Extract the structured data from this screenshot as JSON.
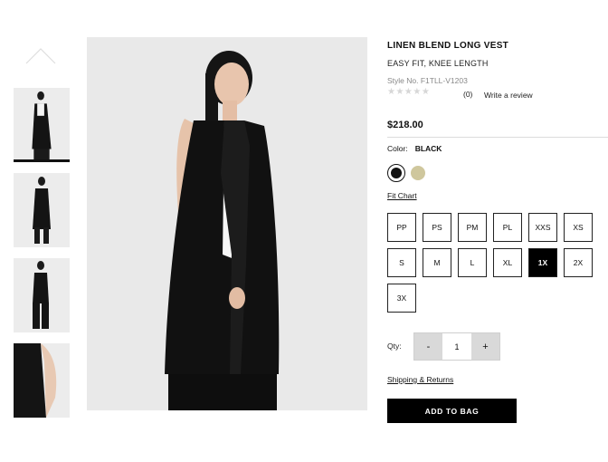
{
  "product": {
    "title": "LINEN BLEND LONG VEST",
    "subtitle": "EASY FIT, KNEE LENGTH",
    "style_no": "Style No. F1TLL-V1203",
    "rating_stars": "★★★★★",
    "review_count": "(0)",
    "write_review": "Write a review",
    "price": "$218.00"
  },
  "color": {
    "label": "Color:",
    "selected": "BLACK",
    "swatches": [
      {
        "name": "black",
        "hex": "#111111"
      },
      {
        "name": "tan",
        "hex": "#cfc79d"
      }
    ]
  },
  "fit_chart": "Fit Chart",
  "sizes": [
    "PP",
    "PS",
    "PM",
    "PL",
    "XXS",
    "XS",
    "S",
    "M",
    "L",
    "XL",
    "1X",
    "2X",
    "3X"
  ],
  "selected_size": "1X",
  "quantity": {
    "label": "Qty:",
    "minus": "-",
    "value": "1",
    "plus": "+"
  },
  "shipping": "Shipping & Returns",
  "add_to_bag": "ADD TO BAG",
  "icons": {
    "thumb_nav": "chevron-up-icon",
    "rating": "star-icon"
  }
}
